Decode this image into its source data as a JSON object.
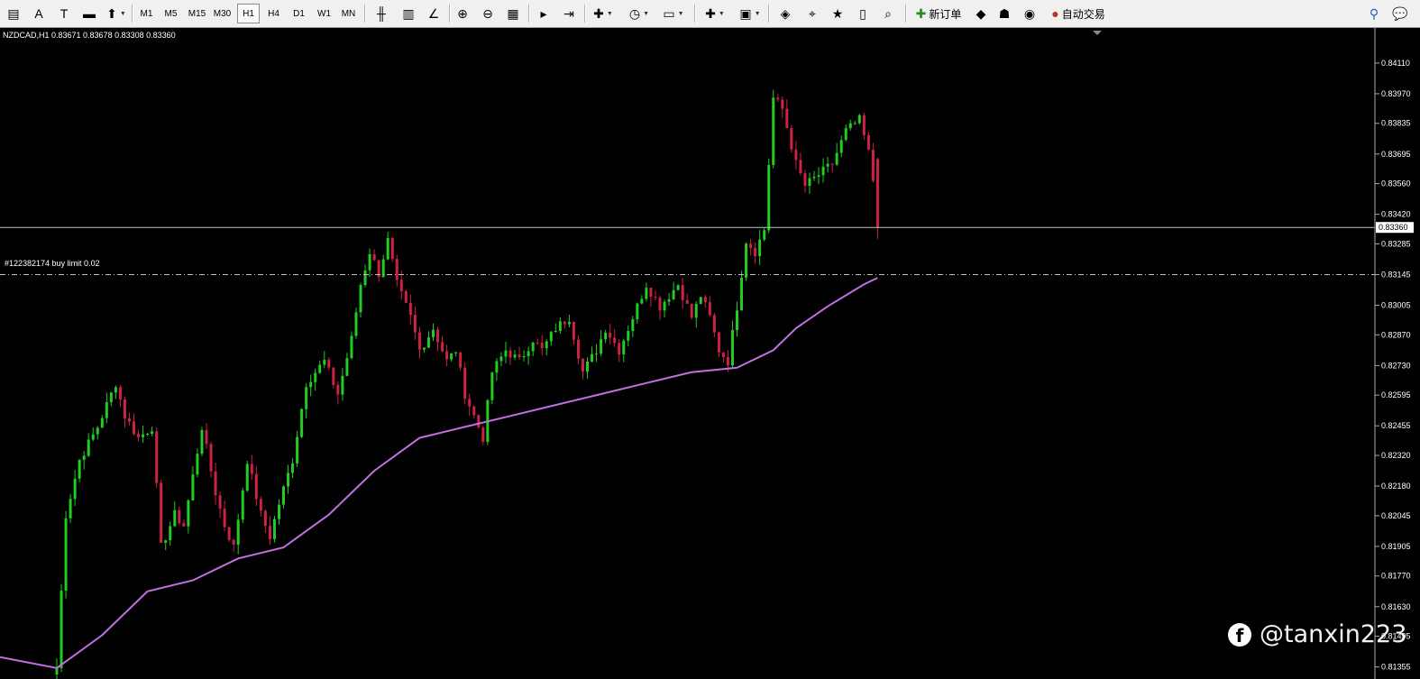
{
  "toolbar": {
    "left_tools": [
      {
        "name": "chart-window-icon",
        "glyph": "▤"
      },
      {
        "name": "text-label-tool-icon",
        "glyph": "A"
      },
      {
        "name": "text-tool-icon",
        "glyph": "T"
      },
      {
        "name": "rectangle-tool-icon",
        "glyph": "▬"
      },
      {
        "name": "arrows-tool-icon",
        "glyph": "⬆"
      }
    ],
    "timeframes": [
      "M1",
      "M5",
      "M15",
      "M30",
      "H1",
      "H4",
      "D1",
      "W1",
      "MN"
    ],
    "active_timeframe": "H1",
    "chart_tools": [
      {
        "name": "bar-chart-icon",
        "glyph": "╫"
      },
      {
        "name": "candlestick-chart-icon",
        "glyph": "▥"
      },
      {
        "name": "line-chart-icon",
        "glyph": "∠"
      },
      {
        "name": "zoom-in-icon",
        "glyph": "⊕"
      },
      {
        "name": "zoom-out-icon",
        "glyph": "⊖"
      },
      {
        "name": "tile-windows-icon",
        "glyph": "▦"
      },
      {
        "name": "auto-scroll-icon",
        "glyph": "▸"
      },
      {
        "name": "chart-shift-icon",
        "glyph": "⇥"
      },
      {
        "name": "indicators-icon",
        "glyph": "✚"
      },
      {
        "name": "periods-icon",
        "glyph": "◷"
      },
      {
        "name": "templates-icon",
        "glyph": "▭"
      },
      {
        "name": "new-chart-icon",
        "glyph": "✚"
      },
      {
        "name": "profiles-icon",
        "glyph": "▣"
      },
      {
        "name": "market-watch-icon",
        "glyph": "◈"
      },
      {
        "name": "crosshair-icon",
        "glyph": "⌖"
      },
      {
        "name": "navigator-icon",
        "glyph": "★"
      },
      {
        "name": "terminal-icon",
        "glyph": "▯"
      },
      {
        "name": "tester-icon",
        "glyph": "⌕"
      }
    ],
    "new_order_label": "新订单",
    "extra_tools": [
      {
        "name": "metaeditor-icon",
        "glyph": "◆"
      },
      {
        "name": "community-icon",
        "glyph": "☗"
      },
      {
        "name": "signals-icon",
        "glyph": "◉"
      }
    ],
    "auto_trading_label": "自动交易",
    "search_icon": "search-icon",
    "chat_icon": "chat-icon"
  },
  "chart": {
    "title": "NZDCAD,H1  0.83671 0.83678 0.83308 0.83360",
    "current_price": "0.83360",
    "order_label": "#122382174 buy limit 0.02",
    "price_labels": [
      "0.84110",
      "0.83970",
      "0.83835",
      "0.83695",
      "0.83560",
      "0.83420",
      "0.83285",
      "0.83145",
      "0.83005",
      "0.82870",
      "0.82730",
      "0.82595",
      "0.82455",
      "0.82320",
      "0.82180",
      "0.82045",
      "0.81905",
      "0.81770",
      "0.81630",
      "0.81495",
      "0.81355"
    ],
    "colors": {
      "background": "#000000",
      "bull": "#22cc22",
      "bear": "#cc2244",
      "moving_average": "#c070e0",
      "price_line": "#c0c0c0",
      "order_line": "#c0c0c0"
    }
  },
  "chart_data": {
    "type": "candlestick",
    "symbol": "NZDCAD",
    "timeframe": "H1",
    "last_bar": {
      "open": 0.83671,
      "high": 0.83678,
      "low": 0.83308,
      "close": 0.8336
    },
    "ylim": [
      0.813,
      0.8427
    ],
    "current_price": 0.8336,
    "buy_limit_price": 0.83145,
    "close_path": [
      [
        0,
        0.8135
      ],
      [
        2,
        0.8205
      ],
      [
        5,
        0.823
      ],
      [
        9,
        0.8245
      ],
      [
        13,
        0.8265
      ],
      [
        15,
        0.825
      ],
      [
        18,
        0.824
      ],
      [
        21,
        0.8245
      ],
      [
        23,
        0.819
      ],
      [
        26,
        0.8205
      ],
      [
        28,
        0.82
      ],
      [
        32,
        0.8245
      ],
      [
        35,
        0.8215
      ],
      [
        37,
        0.82
      ],
      [
        39,
        0.819
      ],
      [
        42,
        0.823
      ],
      [
        45,
        0.8205
      ],
      [
        47,
        0.8195
      ],
      [
        49,
        0.821
      ],
      [
        52,
        0.823
      ],
      [
        55,
        0.8265
      ],
      [
        59,
        0.8275
      ],
      [
        62,
        0.826
      ],
      [
        65,
        0.8285
      ],
      [
        67,
        0.831
      ],
      [
        69,
        0.8325
      ],
      [
        71,
        0.8315
      ],
      [
        73,
        0.833
      ],
      [
        75,
        0.831
      ],
      [
        78,
        0.8295
      ],
      [
        80,
        0.828
      ],
      [
        83,
        0.829
      ],
      [
        86,
        0.8275
      ],
      [
        88,
        0.828
      ],
      [
        90,
        0.826
      ],
      [
        92,
        0.825
      ],
      [
        94,
        0.824
      ],
      [
        96,
        0.827
      ],
      [
        99,
        0.828
      ],
      [
        102,
        0.8275
      ],
      [
        105,
        0.8285
      ],
      [
        107,
        0.828
      ],
      [
        110,
        0.829
      ],
      [
        113,
        0.8295
      ],
      [
        116,
        0.827
      ],
      [
        119,
        0.828
      ],
      [
        121,
        0.829
      ],
      [
        124,
        0.828
      ],
      [
        127,
        0.8295
      ],
      [
        130,
        0.831
      ],
      [
        133,
        0.83
      ],
      [
        135,
        0.8305
      ],
      [
        137,
        0.831
      ],
      [
        140,
        0.8295
      ],
      [
        142,
        0.8305
      ],
      [
        144,
        0.8295
      ],
      [
        146,
        0.828
      ],
      [
        148,
        0.8275
      ],
      [
        150,
        0.83
      ],
      [
        152,
        0.833
      ],
      [
        154,
        0.8325
      ],
      [
        156,
        0.8335
      ],
      [
        158,
        0.8395
      ],
      [
        160,
        0.839
      ],
      [
        163,
        0.8365
      ],
      [
        165,
        0.8355
      ],
      [
        168,
        0.836
      ],
      [
        171,
        0.8365
      ],
      [
        174,
        0.838
      ],
      [
        177,
        0.8385
      ],
      [
        179,
        0.837
      ],
      [
        181,
        0.8345
      ]
    ],
    "moving_average": [
      [
        0,
        0.8135
      ],
      [
        10,
        0.815
      ],
      [
        20,
        0.817
      ],
      [
        30,
        0.8175
      ],
      [
        40,
        0.8185
      ],
      [
        50,
        0.819
      ],
      [
        60,
        0.8205
      ],
      [
        70,
        0.8225
      ],
      [
        80,
        0.824
      ],
      [
        90,
        0.8245
      ],
      [
        100,
        0.825
      ],
      [
        110,
        0.8255
      ],
      [
        120,
        0.826
      ],
      [
        130,
        0.8265
      ],
      [
        140,
        0.827
      ],
      [
        150,
        0.8272
      ],
      [
        158,
        0.828
      ],
      [
        163,
        0.829
      ],
      [
        170,
        0.83
      ],
      [
        178,
        0.831
      ],
      [
        181,
        0.8313
      ]
    ]
  },
  "watermark": {
    "icon": "facebook-icon",
    "handle": "@tanxin223"
  }
}
